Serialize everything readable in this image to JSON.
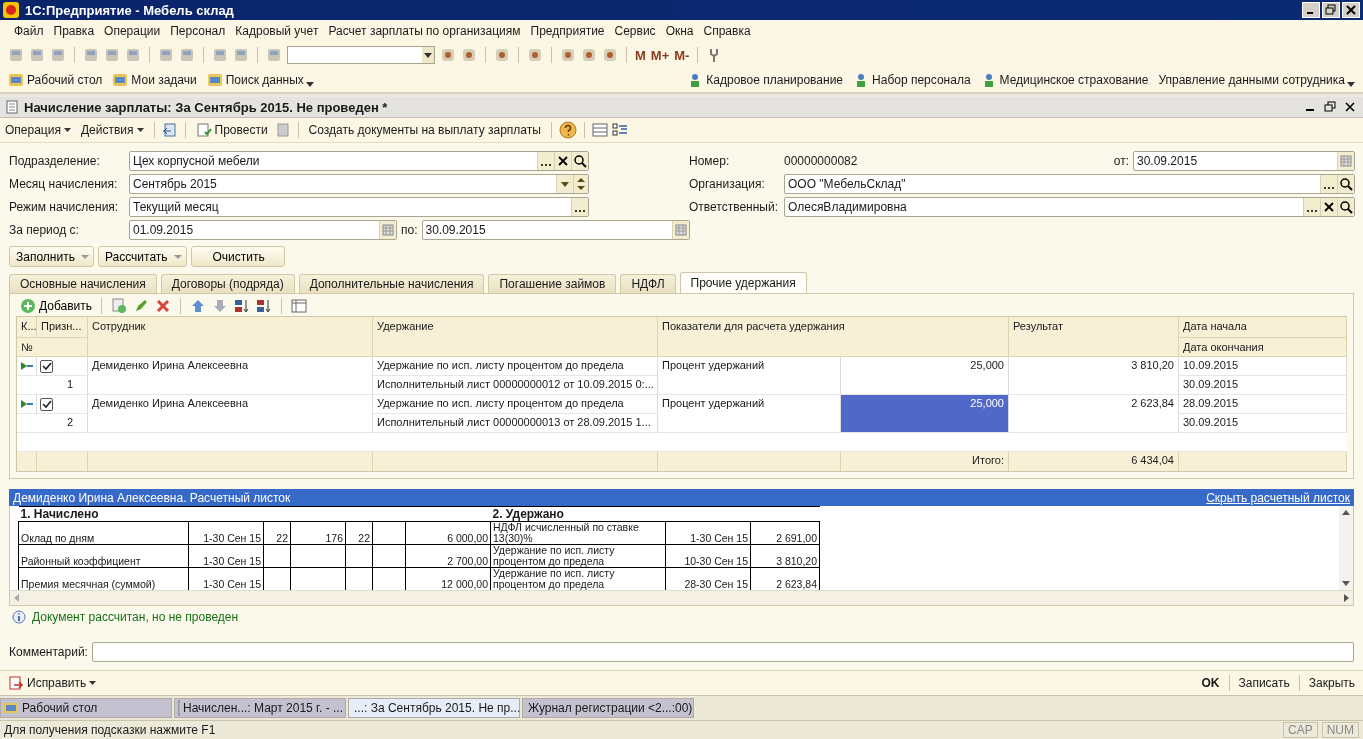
{
  "window": {
    "title": "1С:Предприятие - Мебель склад"
  },
  "menu": [
    "Файл",
    "Правка",
    "Операции",
    "Персонал",
    "Кадровый учет",
    "Расчет зарплаты по организациям",
    "Предприятие",
    "Сервис",
    "Окна",
    "Справка"
  ],
  "toolbar": {
    "memory_buttons": [
      "M",
      "M+",
      "M-"
    ]
  },
  "panel": {
    "left": [
      "Рабочий стол",
      "Мои задачи",
      "Поиск данных"
    ],
    "right": [
      "Кадровое планирование",
      "Набор персонала",
      "Медицинское страхование",
      "Управление данными сотрудника"
    ]
  },
  "document": {
    "title": "Начисление зарплаты: За Сентябрь 2015. Не проведен *",
    "actions": [
      {
        "label": "Операция",
        "kind": "menu"
      },
      {
        "label": "Действия",
        "kind": "menu"
      },
      {
        "label": "Провести",
        "kind": "post"
      },
      {
        "label": "Создать документы на выплату зарплаты",
        "kind": "plain"
      }
    ],
    "fields_left": [
      {
        "label": "Подразделение:",
        "value": "Цех корпусной мебели",
        "kind": "ref"
      },
      {
        "label": "Месяц начисления:",
        "value": "Сентябрь 2015",
        "kind": "month"
      },
      {
        "label": "Режим начисления:",
        "value": "Текущий месяц",
        "kind": "choice"
      }
    ],
    "period": {
      "label": "За период с:",
      "from": "01.09.2015",
      "to_label": "по:",
      "to": "30.09.2015"
    },
    "number": {
      "label": "Номер:",
      "value": "00000000082",
      "date_label": "от:",
      "date": "30.09.2015"
    },
    "fields_right": [
      {
        "label": "Организация:",
        "value": "ООО \"МебельСклад\"",
        "kind": "org"
      },
      {
        "label": "Ответственный:",
        "value": "ОлесяВладимировна",
        "kind": "ref"
      }
    ],
    "buttons": [
      {
        "label": "Заполнить",
        "kind": "menu"
      },
      {
        "label": "Рассчитать",
        "kind": "menu"
      },
      {
        "label": "Очистить",
        "kind": "plain"
      }
    ],
    "tabs": [
      {
        "label": "Основные начисления",
        "selected": false
      },
      {
        "label": "Договоры (подряда)",
        "selected": false
      },
      {
        "label": "Дополнительные начисления",
        "selected": false
      },
      {
        "label": "Погашение займов",
        "selected": false
      },
      {
        "label": "НДФЛ",
        "selected": false
      },
      {
        "label": "Прочие удержания",
        "selected": true
      }
    ],
    "add_button": "Добавить",
    "table": {
      "columns": [
        "К...",
        "Призн...",
        "Сотрудник",
        "Удержание",
        "Показатели для расчета удержания",
        "Результат",
        "Дата начала"
      ],
      "subcolumns": [
        "№",
        "Дата окончания"
      ],
      "rows": [
        {
          "checked": true,
          "number": "1",
          "employee": "Демиденко Ирина Алексеевна",
          "deduction": "Удержание по исп. листу процентом до предела",
          "document": "Исполнительный лист 00000000012 от 10.09.2015 0:...",
          "indicator": "Процент удержаний",
          "value": "25,000",
          "selected": false,
          "result": "3 810,20",
          "date_start": "10.09.2015",
          "date_end": "30.09.2015"
        },
        {
          "checked": true,
          "number": "2",
          "employee": "Демиденко Ирина Алексеевна",
          "deduction": "Удержание по исп. листу процентом до предела",
          "document": "Исполнительный лист 00000000013 от 28.09.2015 1...",
          "indicator": "Процент удержаний",
          "value": "25,000",
          "selected": true,
          "result": "2 623,84",
          "date_start": "28.09.2015",
          "date_end": "30.09.2015"
        }
      ],
      "total_label": "Итого:",
      "total": "6 434,04"
    },
    "payslip": {
      "title": "Демиденко Ирина Алексеевна. Расчетный листок",
      "hide_link": "Скрыть расчетный листок",
      "accrued_heading": "1. Начислено",
      "withheld_heading": "2. Удержано",
      "rows": [
        {
          "accrued": {
            "name": "Оклад по дням",
            "period": "1-30 Сен 15",
            "column_3": "22",
            "column_4": "176",
            "column_5": "22",
            "amount": "6 000,00"
          },
          "withheld": [
            "НДФЛ исчисленный по ставке 13(30)%",
            "1-30 Сен 15",
            "2 691,00"
          ]
        },
        {
          "accrued": {
            "name": "Районный коэффициент",
            "period": "1-30 Сен 15",
            "amount": "2 700,00"
          },
          "withheld": [
            "Удержание по исп. листу процентом до предела",
            "10-30 Сен 15",
            "3 810,20"
          ]
        },
        {
          "accrued": {
            "name": "Премия месячная (суммой)",
            "period": "1-30 Сен 15",
            "amount": "12 000,00"
          },
          "withheld": [
            "Удержание по исп. листу процентом до предела",
            "28-30 Сен 15",
            "2 623,84"
          ]
        }
      ]
    },
    "info": "Документ рассчитан, но не проведен",
    "comment": {
      "label": "Комментарий:"
    },
    "fix_button": "Исправить",
    "footer_buttons": [
      {
        "label": "OK",
        "kind": "default"
      },
      {
        "label": "Записать",
        "kind": "plain"
      },
      {
        "label": "Закрыть",
        "kind": "plain"
      }
    ]
  },
  "taskbar": [
    {
      "label": "Рабочий стол",
      "kind": "desktop",
      "selected": false
    },
    {
      "label": "Начислен...: Март 2015 г. - ...",
      "kind": "doc",
      "selected": false
    },
    {
      "label": "...: За Сентябрь 2015. Не пр...",
      "kind": "doc",
      "selected": true
    },
    {
      "label": "Журнал регистрации <2...:00)",
      "kind": "log",
      "selected": false
    }
  ],
  "status_bar": {
    "hint": "Для получения подсказки нажмите F1",
    "indicators": [
      "CAP",
      "NUM"
    ]
  }
}
